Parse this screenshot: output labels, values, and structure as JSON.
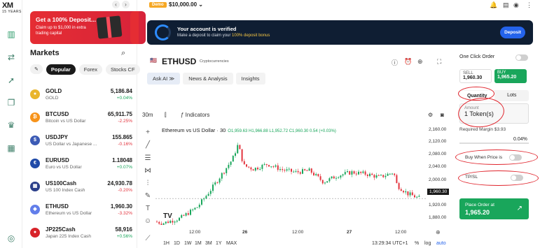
{
  "brand": {
    "logo": "XM",
    "tagline": "15 YEARS"
  },
  "promo": {
    "title": "Get a 100% Deposit...",
    "desc": "Claim up to $1,000 in extra trading capital"
  },
  "markets": {
    "title": "Markets",
    "tabs": [
      "Popular",
      "Forex",
      "Stocks CF"
    ],
    "rows": [
      {
        "symbol": "GOLD",
        "name": "GOLD",
        "price": "5,186.84",
        "change": "+0.04%",
        "dir": "up",
        "color": "#e9b52c",
        "glyph": "●"
      },
      {
        "symbol": "BTCUSD",
        "name": "Bitcoin vs US Dollar",
        "price": "65,911.75",
        "change": "-2.25%",
        "dir": "dn",
        "color": "#f7931a",
        "glyph": "₿"
      },
      {
        "symbol": "USDJPY",
        "name": "US Dollar vs Japanese ...",
        "price": "155.865",
        "change": "-0.16%",
        "dir": "dn",
        "color": "#3c5bb5",
        "glyph": "$"
      },
      {
        "symbol": "EURUSD",
        "name": "Euro vs US Dollar",
        "price": "1.18048",
        "change": "+0.07%",
        "dir": "up",
        "color": "#1f4aa8",
        "glyph": "€"
      },
      {
        "symbol": "US100Cash",
        "name": "US 100 Index Cash",
        "price": "24,930.78",
        "change": "-0.20%",
        "dir": "dn",
        "color": "#2b3f8a",
        "glyph": "▦"
      },
      {
        "symbol": "ETHUSD",
        "name": "Ethereum vs US Dollar",
        "price": "1,960.30",
        "change": "-3.32%",
        "dir": "dn",
        "color": "#627eea",
        "glyph": "◆"
      },
      {
        "symbol": "JP225Cash",
        "name": "Japan 225 Index Cash",
        "price": "58,916",
        "change": "+0.56%",
        "dir": "up",
        "color": "#d8232a",
        "glyph": "●"
      }
    ]
  },
  "header": {
    "demo": "Demo",
    "balance": "$10,000.00",
    "balance_caret": "⌄"
  },
  "banner": {
    "title": "Your account is verified",
    "desc_pre": "Make a deposit to claim your ",
    "desc_hl": "100% deposit bonus",
    "button": "Deposit"
  },
  "instrument": {
    "flag": "🇺🇸",
    "symbol": "ETHUSD",
    "category": "Cryptocurrencies",
    "tabs": [
      "Ask AI ≫",
      "News & Analysis",
      "Insights"
    ]
  },
  "chart": {
    "interval": "30m",
    "indicators": "Indicators",
    "legend_title": "Ethereum vs US Dollar · 30",
    "ohlc": "O1,959.63 H1,966.88 L1,952.72 C1,960.30 0.54 (+0.03%)",
    "y_ticks": [
      "2,160.00",
      "2,120.00",
      "2,080.00",
      "2,040.00",
      "2,000.00",
      "1,960.30",
      "1,920.00",
      "1,880.00"
    ],
    "x_ticks": [
      "12:00",
      "26",
      "12:00",
      "27",
      "12:00"
    ],
    "last_price": "1,960.30",
    "ranges": [
      "1H",
      "1D",
      "1W",
      "1M",
      "3M",
      "1Y",
      "MAX"
    ],
    "clock": "13:29:34 UTC+1",
    "pct": "%",
    "log": "log",
    "auto": "auto",
    "watermark": "TV"
  },
  "order": {
    "one_click": "One Click Order",
    "sell_label": "SELL",
    "sell_price": "1,960.30",
    "buy_label": "BUY",
    "buy_price": "1,965.20",
    "seg": [
      "Quantity",
      "Lots"
    ],
    "amount_label": "Amount",
    "amount_value": "1 Token(s)",
    "required_margin": "Required Margin $3.93",
    "pct": "0.04%",
    "buy_when": "Buy When Price is",
    "tpsl": "TP/SL",
    "place_label": "Place Order at",
    "place_price": "1,965.20"
  },
  "colors": {
    "green": "#19a65b",
    "red": "#e3343e",
    "accent": "#2463eb"
  }
}
